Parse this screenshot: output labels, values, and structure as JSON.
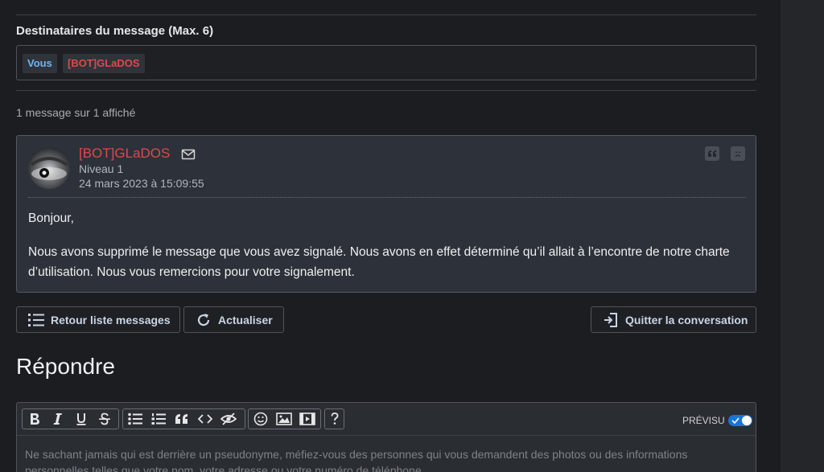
{
  "recipients": {
    "label": "Destinataires du message (Max. 6)",
    "tags": [
      {
        "text": "Vous",
        "color": "#6fb5f4"
      },
      {
        "text": "[BOT]GLaDOS",
        "color": "#e0484b"
      }
    ]
  },
  "count_text": "1 message sur 1 affiché",
  "message": {
    "author": "[BOT]GLaDOS",
    "level": "Niveau 1",
    "date": "24 mars 2023 à 15:09:55",
    "greeting": "Bonjour,",
    "body": "Nous avons supprimé le message que vous avez signalé. Nous avons en effet déterminé qu’il allait à l’encontre de notre charte d’utilisation. Nous vous remercions pour votre signalement.",
    "icons": [
      "mail-icon",
      "quote-icon",
      "report-icon"
    ]
  },
  "actions": {
    "back_label": "Retour liste messages",
    "refresh_label": "Actualiser",
    "quit_label": "Quitter la conversation"
  },
  "reply": {
    "title": "Répondre",
    "toolbar": {
      "tools": [
        "bold",
        "italic",
        "underline",
        "strikethrough",
        "bullet-list",
        "numbered-list",
        "quote",
        "code",
        "spoiler",
        "emoji",
        "image",
        "video",
        "help"
      ],
      "preview_label": "PRÉVISU",
      "preview_enabled": true
    },
    "placeholder": "Ne sachant jamais qui est derrière un pseudonyme, méfiez-vous des personnes qui vous demandent des photos ou des informations personnelles telles que votre nom, votre adresse ou votre numéro de téléphone."
  },
  "colors": {
    "background": "#1b1d21",
    "bot_name": "#e0484b",
    "you_tag": "#6fb5f4",
    "toggle_on": "#1a73d9"
  }
}
